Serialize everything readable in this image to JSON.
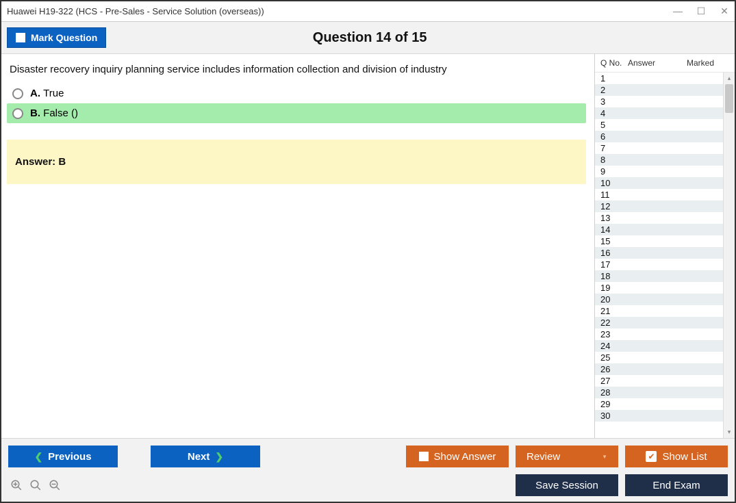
{
  "window": {
    "title": "Huawei H19-322 (HCS - Pre-Sales - Service Solution (overseas))"
  },
  "header": {
    "mark_label": "Mark Question",
    "counter": "Question 14 of 15"
  },
  "question": {
    "text": "Disaster recovery inquiry planning service includes information collection and division of industry",
    "options": [
      {
        "letter": "A.",
        "text": "True",
        "selected": false
      },
      {
        "letter": "B.",
        "text": "False ()",
        "selected": true
      }
    ],
    "answer_label": "Answer: B"
  },
  "side": {
    "headers": {
      "qno": "Q No.",
      "answer": "Answer",
      "marked": "Marked"
    },
    "rows": [
      {
        "n": "1"
      },
      {
        "n": "2"
      },
      {
        "n": "3"
      },
      {
        "n": "4"
      },
      {
        "n": "5"
      },
      {
        "n": "6"
      },
      {
        "n": "7"
      },
      {
        "n": "8"
      },
      {
        "n": "9"
      },
      {
        "n": "10"
      },
      {
        "n": "11"
      },
      {
        "n": "12"
      },
      {
        "n": "13"
      },
      {
        "n": "14"
      },
      {
        "n": "15"
      },
      {
        "n": "16"
      },
      {
        "n": "17"
      },
      {
        "n": "18"
      },
      {
        "n": "19"
      },
      {
        "n": "20"
      },
      {
        "n": "21"
      },
      {
        "n": "22"
      },
      {
        "n": "23"
      },
      {
        "n": "24"
      },
      {
        "n": "25"
      },
      {
        "n": "26"
      },
      {
        "n": "27"
      },
      {
        "n": "28"
      },
      {
        "n": "29"
      },
      {
        "n": "30"
      }
    ]
  },
  "footer": {
    "previous": "Previous",
    "next": "Next",
    "show_answer": "Show Answer",
    "review": "Review",
    "show_list": "Show List",
    "save_session": "Save Session",
    "end_exam": "End Exam"
  }
}
